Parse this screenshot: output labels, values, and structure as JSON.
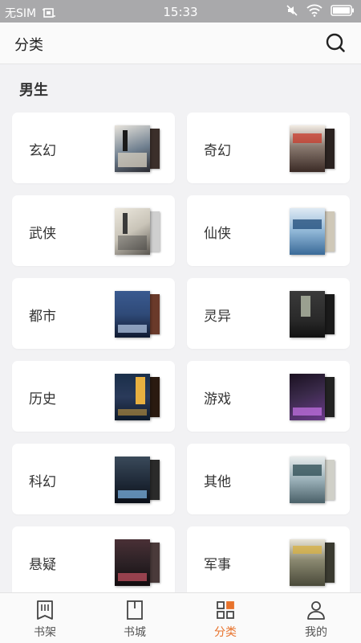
{
  "status_bar": {
    "carrier": "无SIM",
    "time": "15:33"
  },
  "header": {
    "title": "分类"
  },
  "section": {
    "title": "男生"
  },
  "categories": [
    {
      "label": "玄幻",
      "cover_color": "#6f7f8f",
      "cover_accent": "#d8d0c0",
      "back_color": "#3b2f2a"
    },
    {
      "label": "奇幻",
      "cover_color": "#4a3530",
      "cover_accent": "#c83a2a",
      "back_color": "#2a2220"
    },
    {
      "label": "武侠",
      "cover_color": "#c9c4b8",
      "cover_accent": "#3a3a3a",
      "back_color": "#cfcfcf"
    },
    {
      "label": "仙侠",
      "cover_color": "#8fb6d6",
      "cover_accent": "#1e4a78",
      "back_color": "#cfc8b8"
    },
    {
      "label": "都市",
      "cover_color": "#2f4a78",
      "cover_accent": "#b0c4e0",
      "back_color": "#6a3a2a"
    },
    {
      "label": "灵异",
      "cover_color": "#2a2a2a",
      "cover_accent": "#9aa090",
      "back_color": "#1a1a1a"
    },
    {
      "label": "历史",
      "cover_color": "#1a2f4a",
      "cover_accent": "#e8b040",
      "back_color": "#2a1a10"
    },
    {
      "label": "游戏",
      "cover_color": "#3a2a4a",
      "cover_accent": "#c070e0",
      "back_color": "#222222"
    },
    {
      "label": "科幻",
      "cover_color": "#1f2a38",
      "cover_accent": "#7ab0e0",
      "back_color": "#2a2a2a"
    },
    {
      "label": "其他",
      "cover_color": "#9ab0b8",
      "cover_accent": "#2a4a50",
      "back_color": "#d0d0c8"
    },
    {
      "label": "悬疑",
      "cover_color": "#2a2024",
      "cover_accent": "#c05060",
      "back_color": "#4a3a3a"
    },
    {
      "label": "军事",
      "cover_color": "#4a4a3a",
      "cover_accent": "#d8b040",
      "back_color": "#3a3a30"
    }
  ],
  "tabs": [
    {
      "label": "书架",
      "icon": "bookshelf-icon",
      "active": false
    },
    {
      "label": "书城",
      "icon": "bookstore-icon",
      "active": false
    },
    {
      "label": "分类",
      "icon": "category-grid-icon",
      "active": true
    },
    {
      "label": "我的",
      "icon": "profile-icon",
      "active": false
    }
  ],
  "colors": {
    "accent": "#e8732c",
    "background": "#f2f2f4",
    "card": "#ffffff"
  }
}
